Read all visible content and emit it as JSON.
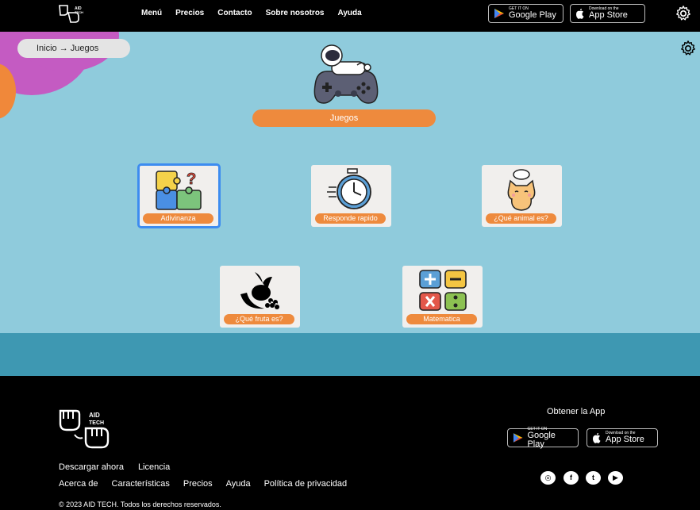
{
  "header": {
    "nav": [
      "Menú",
      "Precios",
      "Contacto",
      "Sobre nosotros",
      "Ayuda"
    ],
    "google_play": {
      "small": "GET IT ON",
      "big": "Google Play"
    },
    "app_store": {
      "small": "Download on the",
      "big": "App Store"
    }
  },
  "breadcrumb": "Inicio → Juegos",
  "page_title": "Juegos",
  "games": [
    {
      "label": "Adivinanza",
      "icon": "puzzle-icon"
    },
    {
      "label": "Responde rapido",
      "icon": "stopwatch-icon"
    },
    {
      "label": "¿Qué animal es?",
      "icon": "cat-icon"
    },
    {
      "label": "¿Qué fruta es?",
      "icon": "fruit-icon"
    },
    {
      "label": "Matematica",
      "icon": "math-icon"
    }
  ],
  "footer": {
    "logo_text": "AID TECH",
    "links_row1": [
      "Descargar ahora",
      "Licencia"
    ],
    "links_row2": [
      "Acerca de",
      "Características",
      "Precios",
      "Ayuda",
      "Política de privacidad"
    ],
    "copyright": "© 2023 AID TECH. Todos los derechos reservados.",
    "get_app": "Obtener la App",
    "social": [
      "instagram-icon",
      "facebook-icon",
      "twitter-icon",
      "youtube-icon"
    ]
  },
  "colors": {
    "accent": "#ee8a3d",
    "main_bg": "#8fcbdc",
    "band": "#3e98b2",
    "selected": "#3d8cf0"
  }
}
